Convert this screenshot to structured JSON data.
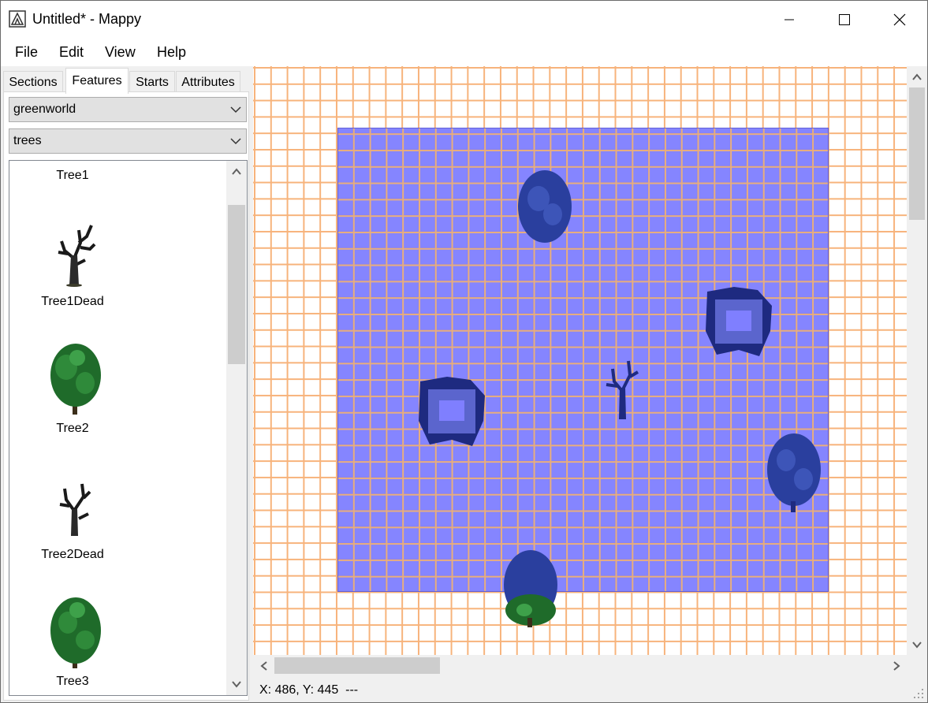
{
  "window": {
    "title": "Untitled* - Mappy"
  },
  "menu": {
    "items": [
      "File",
      "Edit",
      "View",
      "Help"
    ]
  },
  "tabs": [
    {
      "label": "Sections",
      "active": false
    },
    {
      "label": "Features",
      "active": true
    },
    {
      "label": "Starts",
      "active": false
    },
    {
      "label": "Attributes",
      "active": false
    }
  ],
  "selects": {
    "world": "greenworld",
    "category": "trees"
  },
  "features": [
    {
      "label": "Tree1",
      "icon": "tree-icon"
    },
    {
      "label": "Tree1Dead",
      "icon": "dead-tree-icon"
    },
    {
      "label": "Tree2",
      "icon": "tree-icon"
    },
    {
      "label": "Tree2Dead",
      "icon": "dead-tree-icon"
    },
    {
      "label": "Tree3",
      "icon": "tree-icon"
    }
  ],
  "status": {
    "text": "X: 486, Y: 445  ---"
  },
  "colors": {
    "grid": "#f7b37b",
    "map_fill": "#7f7fff",
    "tree_green": "#1f6b2a",
    "tree_blue": "#2a3f9e"
  }
}
